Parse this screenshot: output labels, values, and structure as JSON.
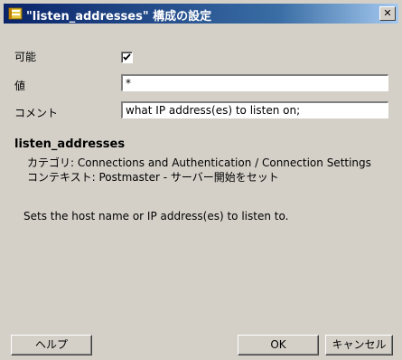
{
  "dialog": {
    "title": "\"listen_addresses\" 構成の設定",
    "close_glyph": "✕"
  },
  "form": {
    "enabled_label": "可能",
    "enabled_checked": true,
    "value_label": "値",
    "value": "*",
    "comment_label": "コメント",
    "comment": "what IP address(es) to listen on;"
  },
  "info": {
    "name": "listen_addresses",
    "category": "カテゴリ: Connections and Authentication / Connection Settings",
    "context": "コンテキスト: Postmaster - サーバー開始をセット",
    "description": "Sets the host name or IP address(es) to listen to."
  },
  "buttons": {
    "help": "ヘルプ",
    "ok": "OK",
    "cancel": "キャンセル"
  }
}
